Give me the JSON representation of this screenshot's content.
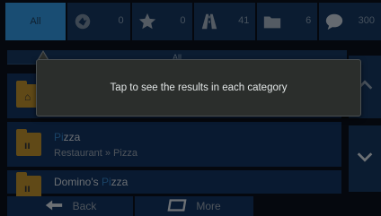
{
  "filters": {
    "all_label": "All",
    "tabs": [
      {
        "icon": "vehicle-icon",
        "count": "0"
      },
      {
        "icon": "star-icon",
        "count": "0"
      },
      {
        "icon": "road-icon",
        "count": "41"
      },
      {
        "icon": "folder-icon",
        "count": "6"
      },
      {
        "icon": "chat-icon",
        "count": "300"
      }
    ]
  },
  "section": {
    "title": "All"
  },
  "results": [
    {
      "title_prefix": "",
      "title_match": "",
      "title_suffix": "",
      "subtitle": ""
    },
    {
      "title_prefix": "",
      "title_match": "Pi",
      "title_suffix": "zza",
      "subtitle": "Restaurant » Pizza"
    },
    {
      "title_prefix": "Domino's ",
      "title_match": "Pi",
      "title_suffix": "zza",
      "subtitle": ""
    }
  ],
  "tooltip": {
    "text": "Tap to see the results in each category"
  },
  "bottom": {
    "back_label": "Back",
    "more_label": "More"
  },
  "colors": {
    "active_tab": "#2e8cd2",
    "tab_bg": "#15335a",
    "highlight": "#2f78b8",
    "folder": "#b0862a"
  }
}
